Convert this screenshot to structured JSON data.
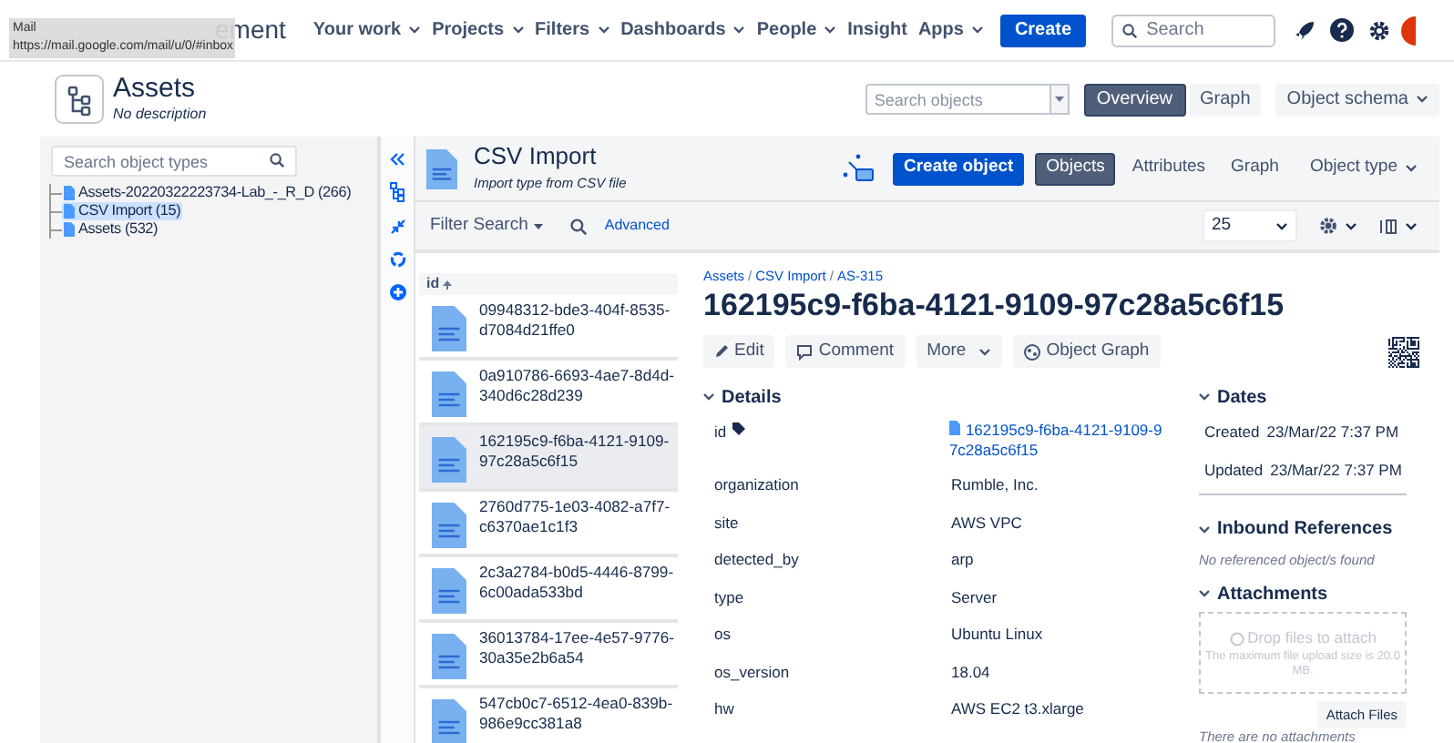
{
  "browser_tooltip": {
    "title": "Mail",
    "url": "https://mail.google.com/mail/u/0/#inbox"
  },
  "top_nav": {
    "app_name": "ement",
    "menus": [
      {
        "label": "Your work",
        "dropdown": true
      },
      {
        "label": "Projects",
        "dropdown": true
      },
      {
        "label": "Filters",
        "dropdown": true
      },
      {
        "label": "Dashboards",
        "dropdown": true
      },
      {
        "label": "People",
        "dropdown": true
      },
      {
        "label": "Insight",
        "dropdown": false
      },
      {
        "label": "Apps",
        "dropdown": true
      }
    ],
    "create_button": "Create",
    "search": {
      "placeholder": "Search"
    }
  },
  "schema_header": {
    "title": "Assets",
    "description": "No description",
    "search": {
      "placeholder": "Search objects"
    },
    "views": [
      {
        "label": "Overview",
        "selected": true
      },
      {
        "label": "Graph",
        "selected": false
      }
    ],
    "schema_menu": "Object schema"
  },
  "object_types": {
    "search": {
      "placeholder": "Search object types"
    },
    "tree": [
      {
        "label": "Assets-20220322223734-Lab_-_R_D (266)",
        "selected": false
      },
      {
        "label": "CSV Import (15)",
        "selected": true
      },
      {
        "label": "Assets (532)",
        "selected": false
      }
    ]
  },
  "object_type": {
    "title": "CSV Import",
    "description": "Import type from CSV file",
    "create_button": "Create object",
    "tabs": [
      {
        "label": "Objects",
        "selected": true
      },
      {
        "label": "Attributes",
        "selected": false
      },
      {
        "label": "Graph",
        "selected": false
      }
    ],
    "type_menu": "Object type"
  },
  "filter_bar": {
    "filter_menu": "Filter Search",
    "advanced_link": "Advanced",
    "page_size": "25"
  },
  "object_list": {
    "column": "id",
    "rows": [
      {
        "label": "09948312-bde3-404f-8535-d7084d21ffe0",
        "selected": false
      },
      {
        "label": "0a910786-6693-4ae7-8d4d-340d6c28d239",
        "selected": false
      },
      {
        "label": "162195c9-f6ba-4121-9109-97c28a5c6f15",
        "selected": true
      },
      {
        "label": "2760d775-1e03-4082-a7f7-c6370ae1c1f3",
        "selected": false
      },
      {
        "label": "2c3a2784-b0d5-4446-8799-6c00ada533bd",
        "selected": false
      },
      {
        "label": "36013784-17ee-4e57-9776-30a35e2b6a54",
        "selected": false
      },
      {
        "label": "547cb0c7-6512-4ea0-839b-986e9cc381a8",
        "selected": false
      }
    ]
  },
  "object": {
    "breadcrumb": [
      {
        "label": "Assets",
        "kind": "link"
      },
      {
        "label": "/",
        "kind": "separator"
      },
      {
        "label": "CSV Import",
        "kind": "link"
      },
      {
        "label": "/",
        "kind": "separator"
      },
      {
        "label": "AS-315",
        "kind": "link"
      }
    ],
    "title": "162195c9-f6ba-4121-9109-97c28a5c6f15",
    "actions": [
      {
        "label": "Edit",
        "kind": "edit"
      },
      {
        "label": "Comment",
        "kind": "comment"
      },
      {
        "label": "More",
        "kind": "more"
      },
      {
        "label": "Object Graph",
        "kind": "graph"
      }
    ]
  },
  "details": {
    "title": "Details",
    "attributes": [
      {
        "name": "id",
        "value": "162195c9-f6ba-4121-9109-97c28a5c6f15",
        "kind": "link"
      },
      {
        "name": "organization",
        "value": "Rumble, Inc.",
        "kind": "text"
      },
      {
        "name": "site",
        "value": "AWS VPC",
        "kind": "text"
      },
      {
        "name": "detected_by",
        "value": "arp",
        "kind": "text"
      },
      {
        "name": "type",
        "value": "Server",
        "kind": "text"
      },
      {
        "name": "os",
        "value": "Ubuntu Linux",
        "kind": "text"
      },
      {
        "name": "os_version",
        "value": "18.04",
        "kind": "text"
      },
      {
        "name": "hw",
        "value": "AWS EC2 t3.xlarge",
        "kind": "text"
      }
    ]
  },
  "dates": {
    "title": "Dates",
    "rows": [
      {
        "label": "Created",
        "value": "23/Mar/22 7:37 PM"
      },
      {
        "label": "Updated",
        "value": "23/Mar/22 7:37 PM"
      }
    ]
  },
  "inbound_references": {
    "title": "Inbound References",
    "empty_text": "No referenced object/s found"
  },
  "attachments": {
    "title": "Attachments",
    "drop_text": "Drop files to attach",
    "limit_text": "The maximum file upload size is 20.0 MB.",
    "button": "Attach Files",
    "empty_text": "There are no attachments"
  }
}
